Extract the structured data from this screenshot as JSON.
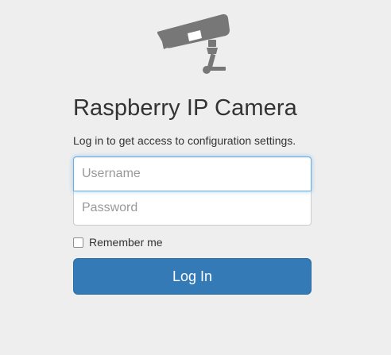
{
  "app": {
    "logo_icon": "security-camera-icon",
    "title": "Raspberry IP Camera",
    "subtitle": "Log in to get access to configuration settings."
  },
  "form": {
    "username": {
      "value": "",
      "placeholder": "Username"
    },
    "password": {
      "value": "",
      "placeholder": "Password"
    },
    "remember_label": "Remember me",
    "remember_checked": false,
    "submit_label": "Log In"
  },
  "colors": {
    "background": "#eeeeee",
    "primary_button": "#337ab7",
    "focus_border": "#66afe9",
    "icon": "#777777"
  }
}
